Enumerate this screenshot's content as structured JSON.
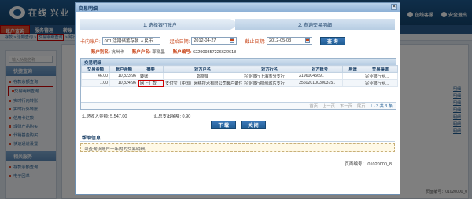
{
  "app": {
    "logo_text": "兴业",
    "logo_prefix": "在线",
    "top_links": [
      "在线客服",
      "安全退出"
    ]
  },
  "nav": {
    "items": [
      {
        "label": "账户查询",
        "active": true
      },
      {
        "label": "服务管理",
        "active": false
      },
      {
        "label": "转账",
        "active": false
      }
    ]
  },
  "crumb": {
    "prefix": "存款 > 活期查询 > ",
    "highlight": "交易明细查询",
    "suffix": " > 跨行交易"
  },
  "sidebar": {
    "search_placeholder": "输入功能名称",
    "groups": [
      {
        "title": "快捷查询",
        "items": [
          {
            "label": "存款余额查询",
            "active": false
          },
          {
            "label": "交易明细查询",
            "active": true
          },
          {
            "label": "实时行内转账",
            "active": false
          },
          {
            "label": "实时行外转账",
            "active": false
          },
          {
            "label": "信用卡还款",
            "active": false
          },
          {
            "label": "理财产品购买",
            "active": false
          },
          {
            "label": "代销基金购买",
            "active": false
          },
          {
            "label": "快速通道设置",
            "active": false
          }
        ]
      },
      {
        "title": "相关服务",
        "items": [
          {
            "label": "存款余额查询",
            "active": false
          },
          {
            "label": "电子回单",
            "active": false
          }
        ]
      }
    ]
  },
  "background": {
    "right_links": [
      "明细",
      "明细",
      "明细",
      "明细",
      "明细",
      "明细",
      "明细"
    ],
    "footer": "页面编号：01020000_0"
  },
  "modal": {
    "title": "交易明细",
    "close_icon": "close-icon",
    "steps": [
      "1. 选择银行账户",
      "2. 查询交易明细"
    ],
    "form": {
      "account_label": "卡内账户:",
      "account_value": "001 活期储蓄存款 人民币",
      "start_label": "起始日期:",
      "start_value": "2012-04-27",
      "end_label": "截止日期:",
      "end_value": "2012-05-03",
      "query_button": "查 询"
    },
    "info": {
      "branch_label": "账户别名:",
      "branch_value": "杭州卡",
      "name_label": "账户户名:",
      "name_value": "郭晓晶",
      "number_label": "账户编号:",
      "number_value": "622909357226622618"
    },
    "table": {
      "title": "交易明细",
      "columns": [
        "交易金额",
        "账户余额",
        "摘要",
        "对方户名",
        "对方行名",
        "对方账号",
        "用途",
        "交易渠道"
      ],
      "rows": [
        {
          "amount": "46.00",
          "balance": "10,823.96",
          "summary": "转账",
          "cp_name": "郭晓晶",
          "cp_bank": "兴业银行上海市分支行",
          "cp_account": "21960045691",
          "purpose": "",
          "channel": "兴业银行网..."
        },
        {
          "amount": "1.00",
          "balance": "10,824.96",
          "summary": "网上汇款",
          "cp_name": "支付宝（中国）网络技术有限公司客户备付金",
          "cp_bank": "兴业银行杭州城东支行",
          "cp_account": "3560201003003751",
          "purpose": "",
          "channel": "兴业银行网..."
        }
      ],
      "pager": {
        "first": "首页",
        "prev": "上一页",
        "next": "下一页",
        "last": "尾页",
        "range": "1 - 3 共 3 条"
      }
    },
    "summary": {
      "income_label": "汇总收入金额:",
      "income_value": "5,547.00",
      "expense_label": "汇总支出金额:",
      "expense_value": "0.90"
    },
    "actions": {
      "download": "下 载",
      "close": "关 闭"
    },
    "help": {
      "title": "帮助信息",
      "text": "可查询该账户一年内的交易明细。"
    },
    "page_number": "页面编号：  01020000_8"
  }
}
